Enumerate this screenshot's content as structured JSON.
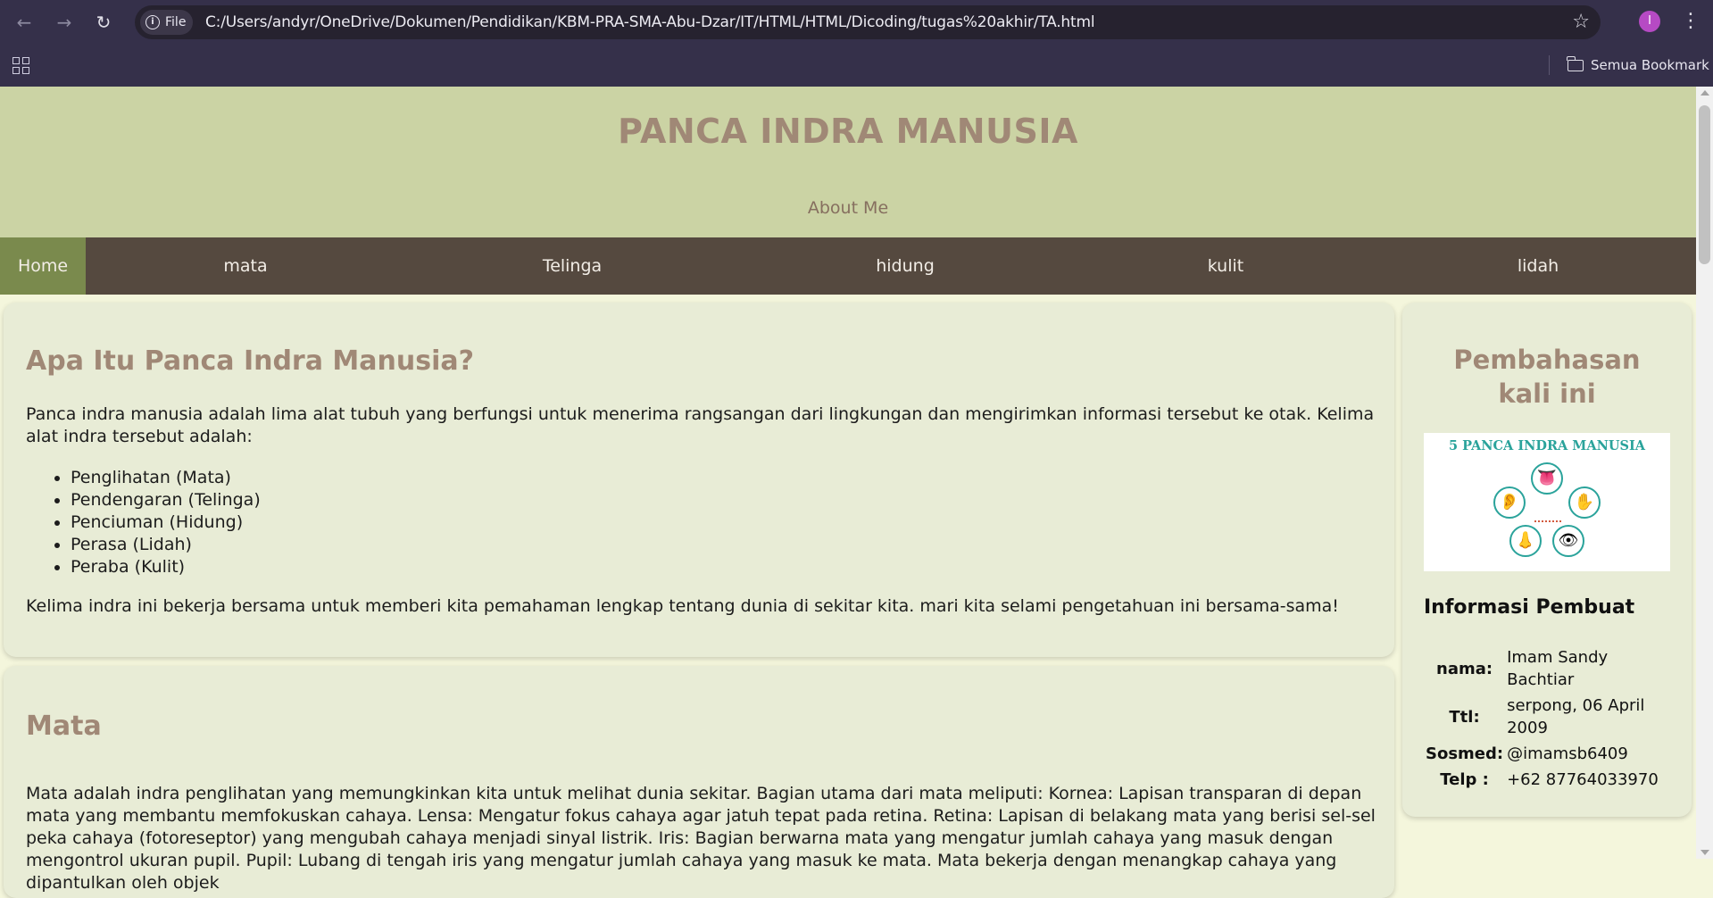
{
  "browser": {
    "file_chip_label": "File",
    "url": "C:/Users/andyr/OneDrive/Dokumen/Pendidikan/KBM-PRA-SMA-Abu-Dzar/IT/HTML/HTML/Dicoding/tugas%20akhir/TA.html",
    "profile_initial": "I",
    "all_bookmarks_label": "Semua Bookmark"
  },
  "header": {
    "title": "PANCA INDRA MANUSIA",
    "about_link": "About Me"
  },
  "nav": {
    "items": [
      {
        "label": "Home"
      },
      {
        "label": "mata"
      },
      {
        "label": "Telinga"
      },
      {
        "label": "hidung"
      },
      {
        "label": "kulit"
      },
      {
        "label": "lidah"
      }
    ]
  },
  "intro": {
    "heading": "Apa Itu Panca Indra Manusia?",
    "paragraph": "Panca indra manusia adalah lima alat tubuh yang berfungsi untuk menerima rangsangan dari lingkungan dan mengirimkan informasi tersebut ke otak. Kelima alat indra tersebut adalah:",
    "list": [
      "Penglihatan (Mata)",
      "Pendengaran (Telinga)",
      "Penciuman (Hidung)",
      "Perasa (Lidah)",
      "Peraba (Kulit)"
    ],
    "closing": "Kelima indra ini bekerja bersama untuk memberi kita pemahaman lengkap tentang dunia di sekitar kita. mari kita selami pengetahuan ini bersama-sama!"
  },
  "mata": {
    "heading": "Mata",
    "paragraph": "Mata adalah indra penglihatan yang memungkinkan kita untuk melihat dunia sekitar. Bagian utama dari mata meliputi: Kornea: Lapisan transparan di depan mata yang membantu memfokuskan cahaya. Lensa: Mengatur fokus cahaya agar jatuh tepat pada retina. Retina: Lapisan di belakang mata yang berisi sel-sel peka cahaya (fotoreseptor) yang mengubah cahaya menjadi sinyal listrik. Iris: Bagian berwarna mata yang mengatur jumlah cahaya yang masuk dengan mengontrol ukuran pupil. Pupil: Lubang di tengah iris yang mengatur jumlah cahaya yang masuk ke mata. Mata bekerja dengan menangkap cahaya yang dipantulkan oleh objek"
  },
  "aside": {
    "title": "Pembahasan kali ini",
    "image_title": "5 PANCA INDRA MANUSIA",
    "info_title": "Informasi Pembuat",
    "info_rows": [
      {
        "label": "nama:",
        "value": "Imam Sandy Bachtiar"
      },
      {
        "label": "Ttl:",
        "value": "serpong, 06 April 2009"
      },
      {
        "label": "Sosmed:",
        "value": "@imamsb6409"
      },
      {
        "label": "Telp :",
        "value": "+62 87764033970"
      }
    ]
  }
}
